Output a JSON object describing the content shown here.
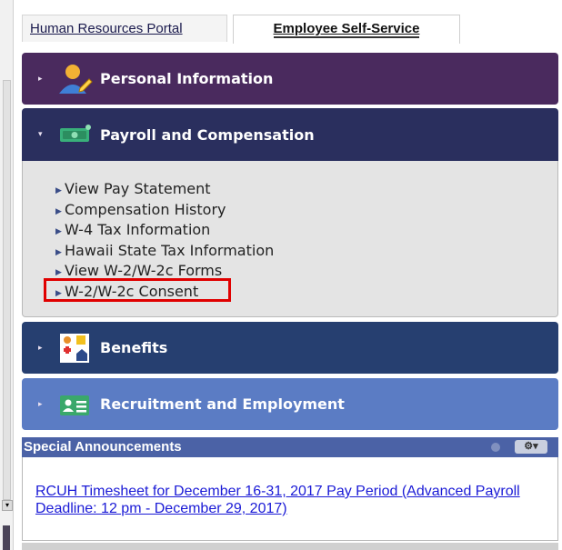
{
  "tabs": {
    "hr_portal": "Human Resources Portal",
    "ess": "Employee Self-Service"
  },
  "panels": {
    "personal": {
      "title": "Personal Information",
      "color": "#4a2a5e",
      "icon": "person-edit-icon"
    },
    "payroll": {
      "title": "Payroll and Compensation",
      "color": "#2a2f5e",
      "icon": "money-icon",
      "links": [
        "View Pay Statement",
        "Compensation History",
        "W-4 Tax Information",
        "Hawaii State Tax Information",
        "View W-2/W-2c Forms",
        "W-2/W-2c Consent"
      ]
    },
    "benefits": {
      "title": "Benefits",
      "color": "#263f70",
      "icon": "family-health-icon"
    },
    "recruit": {
      "title": "Recruitment and Employment",
      "color": "#5b7cc4",
      "icon": "id-card-icon"
    }
  },
  "announcements": {
    "header": "Special Announcements",
    "link": "RCUH Timesheet for December 16-31, 2017 Pay Period (Advanced Payroll Deadline: 12 pm - December 29, 2017)"
  },
  "highlight_color": "#e00000"
}
